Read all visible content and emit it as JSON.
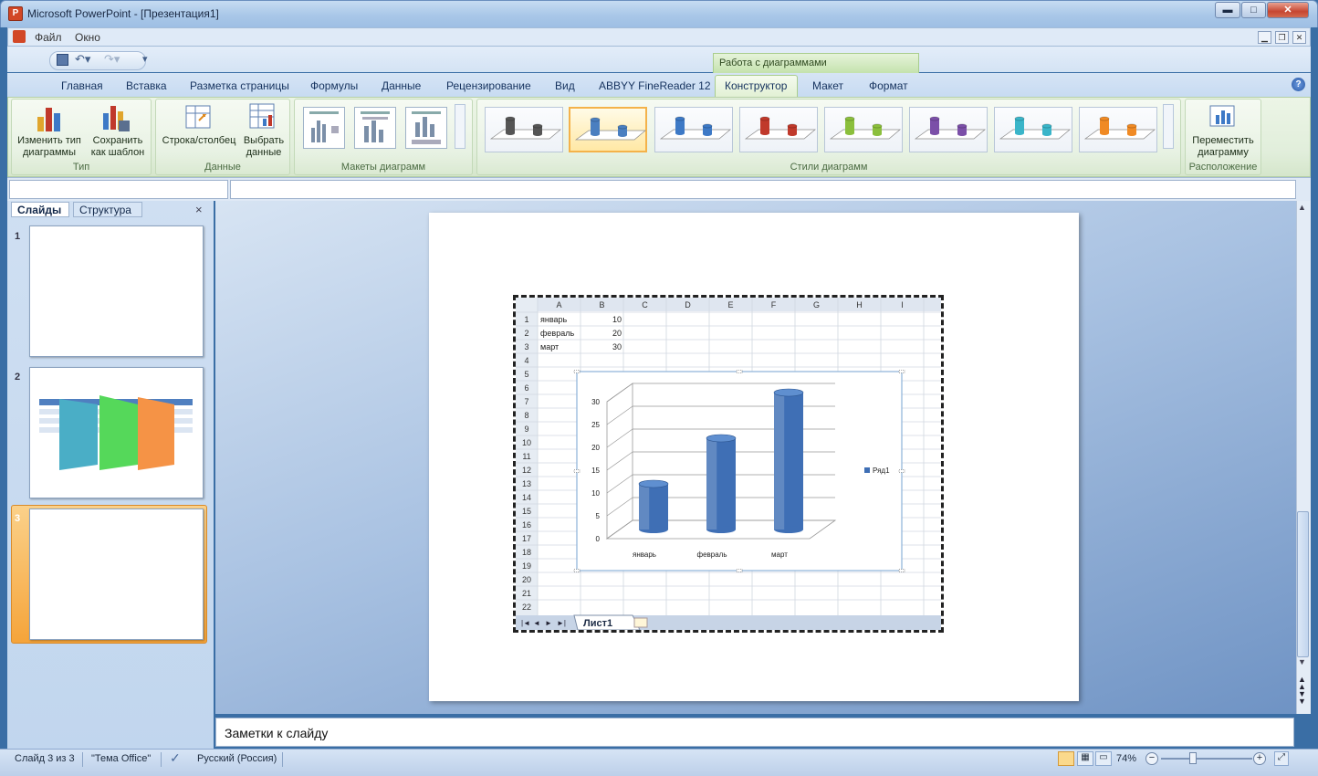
{
  "window": {
    "title": "Microsoft PowerPoint - [Презентация1]",
    "minimize": "▬",
    "maximize": "□",
    "close": "✕"
  },
  "menu": {
    "items": [
      "Файл",
      "Окно"
    ]
  },
  "ribbon": {
    "context_group": "Работа с диаграммами",
    "tabs": [
      "Главная",
      "Вставка",
      "Разметка страницы",
      "Формулы",
      "Данные",
      "Рецензирование",
      "Вид",
      "ABBYY FineReader 12",
      "Конструктор",
      "Макет",
      "Формат"
    ],
    "active_tab": "Конструктор",
    "groups": {
      "type": {
        "label": "Тип",
        "change_type": [
          "Изменить тип",
          "диаграммы"
        ],
        "save_template": [
          "Сохранить",
          "как шаблон"
        ]
      },
      "data": {
        "label": "Данные",
        "row_col": "Строка/столбец",
        "select_data": [
          "Выбрать",
          "данные"
        ]
      },
      "layouts": {
        "label": "Макеты диаграмм"
      },
      "styles": {
        "label": "Стили диаграмм",
        "colors": [
          "#555555",
          "#4a7fc0",
          "#3d79c6",
          "#c0392b",
          "#8bbf3c",
          "#7b4fa8",
          "#3ab5c9",
          "#f08a24"
        ]
      },
      "location": {
        "label": "Расположение",
        "move_chart": [
          "Переместить",
          "диаграмму"
        ]
      }
    }
  },
  "left_pane": {
    "tab_slides": "Слайды",
    "tab_outline": "Структура",
    "close": "×",
    "slides": [
      "1",
      "2",
      "3"
    ]
  },
  "spreadsheet": {
    "columns": [
      "A",
      "B",
      "C",
      "D",
      "E",
      "F",
      "G",
      "H",
      "I"
    ],
    "row_numbers": [
      "1",
      "2",
      "3",
      "4",
      "5",
      "6",
      "7",
      "8",
      "9",
      "10",
      "11",
      "12",
      "13",
      "14",
      "15",
      "16",
      "17",
      "18",
      "19",
      "20",
      "21",
      "22"
    ],
    "cells": [
      [
        "январь",
        "10"
      ],
      [
        "февраль",
        "20"
      ],
      [
        "март",
        "30"
      ]
    ],
    "sheet_tab": "Лист1",
    "nav": [
      "|◄",
      "◄",
      "►",
      "►|"
    ]
  },
  "chart_data": {
    "type": "bar",
    "categories": [
      "январь",
      "февраль",
      "март"
    ],
    "series": [
      {
        "name": "Ряд1",
        "values": [
          10,
          20,
          30
        ]
      }
    ],
    "ylim": [
      0,
      30
    ],
    "yticks": [
      "0",
      "5",
      "10",
      "15",
      "20",
      "25",
      "30"
    ],
    "legend": "right",
    "grid": true,
    "bar_color": "#3f6fb5"
  },
  "notes": {
    "placeholder": "Заметки к слайду"
  },
  "status": {
    "slide": "Слайд 3 из 3",
    "theme": "\"Тема Office\"",
    "language": "Русский (Россия)",
    "zoom": "74%"
  }
}
